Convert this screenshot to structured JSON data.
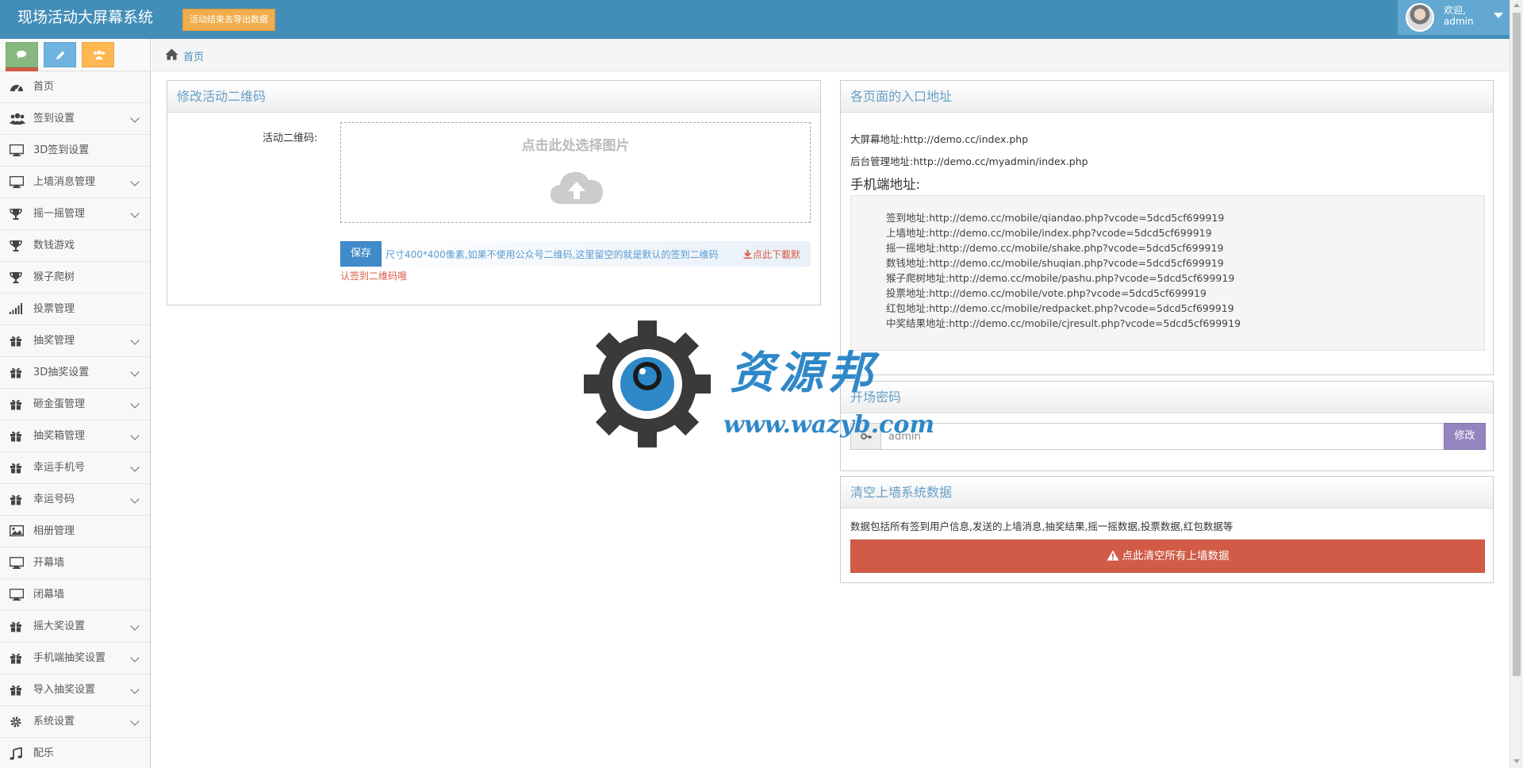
{
  "navbar": {
    "brand": "现场活动大屏幕系统",
    "export_button": "活动结束去导出数据",
    "user": {
      "welcome": "欢迎,",
      "name": "admin"
    }
  },
  "shortcuts": [
    {
      "name": "comments-shortcut",
      "icon": "comments-icon",
      "color": "#87b87f"
    },
    {
      "name": "edit-shortcut",
      "icon": "pencil-icon",
      "color": "#6fb3e0"
    },
    {
      "name": "users-shortcut",
      "icon": "group-icon",
      "color": "#ffb752"
    },
    {
      "name": "settings-shortcut",
      "icon": "cogs-icon",
      "color": "#d15b47"
    }
  ],
  "sidebar": {
    "items": [
      {
        "label": "首页",
        "icon": "dashboard-icon",
        "arrow": false
      },
      {
        "label": "签到设置",
        "icon": "users-icon",
        "arrow": true
      },
      {
        "label": "3D签到设置",
        "icon": "desktop-icon",
        "arrow": false
      },
      {
        "label": "上墙消息管理",
        "icon": "desktop-icon",
        "arrow": true
      },
      {
        "label": "摇一摇管理",
        "icon": "trophy-icon",
        "arrow": true
      },
      {
        "label": "数钱游戏",
        "icon": "trophy-icon",
        "arrow": false
      },
      {
        "label": "猴子爬树",
        "icon": "trophy-icon",
        "arrow": false
      },
      {
        "label": "投票管理",
        "icon": "signal-icon",
        "arrow": false
      },
      {
        "label": "抽奖管理",
        "icon": "gift-icon",
        "arrow": true
      },
      {
        "label": "3D抽奖设置",
        "icon": "gift-icon",
        "arrow": true
      },
      {
        "label": "砸金蛋管理",
        "icon": "gift-icon",
        "arrow": true
      },
      {
        "label": "抽奖箱管理",
        "icon": "gift-icon",
        "arrow": true
      },
      {
        "label": "幸运手机号",
        "icon": "gift-icon",
        "arrow": true
      },
      {
        "label": "幸运号码",
        "icon": "gift-icon",
        "arrow": true
      },
      {
        "label": "相册管理",
        "icon": "picture-icon",
        "arrow": false
      },
      {
        "label": "开幕墙",
        "icon": "desktop-icon",
        "arrow": false
      },
      {
        "label": "闭幕墙",
        "icon": "desktop-icon",
        "arrow": false
      },
      {
        "label": "摇大奖设置",
        "icon": "gift-icon",
        "arrow": true
      },
      {
        "label": "手机端抽奖设置",
        "icon": "gift-icon",
        "arrow": true
      },
      {
        "label": "导入抽奖设置",
        "icon": "gift-icon",
        "arrow": true
      },
      {
        "label": "系统设置",
        "icon": "cog-icon",
        "arrow": true
      },
      {
        "label": "配乐",
        "icon": "music-icon",
        "arrow": false
      }
    ]
  },
  "breadcrumb": {
    "home": "首页"
  },
  "qrcode_widget": {
    "title": "修改活动二维码",
    "field_label": "活动二维码:",
    "upload_text": "点击此处选择图片",
    "save_button": "保存",
    "help_text": "尺寸400*400像素,如果不使用公众号二维码,这里留空的就是默认的签到二维码",
    "download_link_part1": "点此下載默",
    "download_link_part2": "认签到二维码哦"
  },
  "entry_widget": {
    "title": "各页面的入口地址",
    "screen_addr": "大屏幕地址:http://demo.cc/index.php",
    "admin_addr": "后台管理地址:http://demo.cc/myadmin/index.php",
    "mobile_title": "手机端地址:",
    "mobile_lines": [
      "签到地址:http://demo.cc/mobile/qiandao.php?vcode=5dcd5cf699919",
      "上墙地址:http://demo.cc/mobile/index.php?vcode=5dcd5cf699919",
      "摇一摇地址:http://demo.cc/mobile/shake.php?vcode=5dcd5cf699919",
      "数钱地址:http://demo.cc/mobile/shuqian.php?vcode=5dcd5cf699919",
      "猴子爬树地址:http://demo.cc/mobile/pashu.php?vcode=5dcd5cf699919",
      "投票地址:http://demo.cc/mobile/vote.php?vcode=5dcd5cf699919",
      "红包地址:http://demo.cc/mobile/redpacket.php?vcode=5dcd5cf699919",
      "中奖结果地址:http://demo.cc/mobile/cjresult.php?vcode=5dcd5cf699919"
    ]
  },
  "password_widget": {
    "title": "开场密码",
    "value": "admin",
    "button": "修改"
  },
  "clear_widget": {
    "title": "清空上墙系统数据",
    "description": "数据包括所有签到用户信息,发送的上墙消息,抽奖结果,摇一摇数据,投票数据,红包数据等",
    "button": "点此清空所有上墙数据"
  },
  "watermark": {
    "text": "资源邦",
    "url": "www.wazyb.com"
  },
  "colors": {
    "navbar": "#438eb9",
    "title": "#669fc7",
    "danger": "#d15b47",
    "purple": "#9585bf",
    "primary": "#428bca"
  }
}
